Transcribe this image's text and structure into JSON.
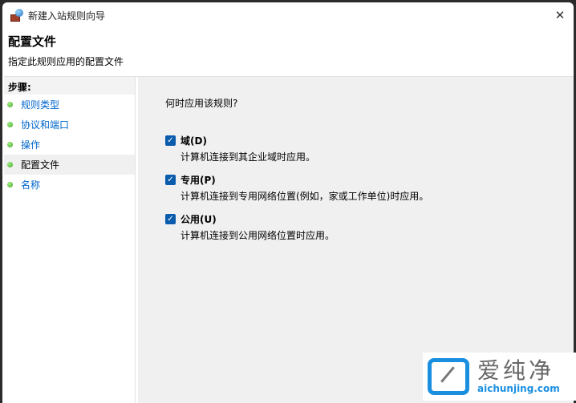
{
  "window": {
    "title": "新建入站规则向导",
    "close": "✕"
  },
  "header": {
    "title": "配置文件",
    "subtitle": "指定此规则应用的配置文件"
  },
  "steps": {
    "heading": "步骤:",
    "items": [
      {
        "label": "规则类型"
      },
      {
        "label": "协议和端口"
      },
      {
        "label": "操作"
      },
      {
        "label": "配置文件"
      },
      {
        "label": "名称"
      }
    ]
  },
  "main": {
    "question": "何时应用该规则?",
    "options": [
      {
        "label": "域(D)",
        "checked": true,
        "desc": "计算机连接到其企业域时应用。"
      },
      {
        "label": "专用(P)",
        "checked": true,
        "desc": "计算机连接到专用网络位置(例如，家或工作单位)时应用。"
      },
      {
        "label": "公用(U)",
        "checked": true,
        "desc": "计算机连接到公用网络位置时应用。"
      }
    ]
  },
  "watermark": {
    "text": "爱纯净",
    "url": "aichunjing.com"
  }
}
